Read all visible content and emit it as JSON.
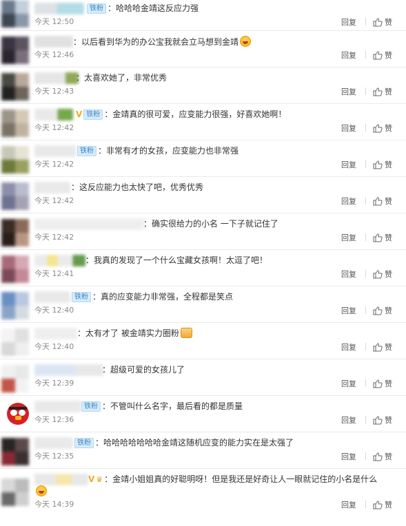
{
  "comments": [
    {
      "badge": "铁粉",
      "verified": false,
      "crown": false,
      "text": "哈哈哈金靖这反应力强",
      "emoji": "",
      "time": "今天 12:50"
    },
    {
      "badge": "",
      "verified": false,
      "crown": false,
      "text": "以后看到华为的办公宝我就会立马想到金靖",
      "emoji": "laugh",
      "time": "今天 12:46"
    },
    {
      "badge": "",
      "verified": false,
      "crown": false,
      "text": "太喜欢她了，非常优秀",
      "emoji": "",
      "time": "今天 12:43"
    },
    {
      "badge": "铁粉",
      "verified": true,
      "crown": false,
      "text": "金靖真的很可爱，应变能力很强，好喜欢她啊！",
      "emoji": "",
      "time": "今天 12:42"
    },
    {
      "badge": "铁粉",
      "verified": false,
      "crown": false,
      "text": "非常有才的女孩，应变能力也非常强",
      "emoji": "",
      "time": "今天 12:42"
    },
    {
      "badge": "",
      "verified": false,
      "crown": false,
      "text": "这反应能力也太快了吧，优秀优秀",
      "emoji": "",
      "time": "今天 12:42"
    },
    {
      "badge": "",
      "verified": false,
      "crown": false,
      "text": "确实很给力的小名 一下子就记住了",
      "emoji": "",
      "time": "今天 12:42"
    },
    {
      "badge": "",
      "verified": false,
      "crown": false,
      "text": "我真的发现了一个什么宝藏女孩啊！太逗了吧！",
      "emoji": "",
      "time": "今天 12:41"
    },
    {
      "badge": "铁粉",
      "verified": false,
      "crown": false,
      "text": "真的应变能力非常强，全程都是笑点",
      "emoji": "",
      "time": "今天 12:40"
    },
    {
      "badge": "",
      "verified": false,
      "crown": false,
      "text": "太有才了 被金靖实力圈粉",
      "emoji": "thumb",
      "time": "今天 12:40"
    },
    {
      "badge": "",
      "verified": false,
      "crown": false,
      "text": "超级可爱的女孩儿了",
      "emoji": "",
      "time": "今天 12:39"
    },
    {
      "badge": "铁粉",
      "verified": false,
      "crown": false,
      "text": "不管叫什么名字，最后看的都是质量",
      "emoji": "",
      "time": "今天 12:36"
    },
    {
      "badge": "铁粉",
      "verified": false,
      "crown": false,
      "text": "哈哈哈哈哈哈哈金靖这随机应变的能力实在是太强了",
      "emoji": "",
      "time": "今天 12:35"
    },
    {
      "badge": "",
      "verified": true,
      "crown": true,
      "text": "金靖小姐姐真的好聪明呀！但是我还是好奇让人一眼就记住的小名是什么",
      "emoji": "laugh",
      "time": "今天 14:39"
    }
  ],
  "actions": {
    "reply_label": "回复",
    "like_label": "赞"
  },
  "colors": {
    "badge_bg": "#d6ebfa",
    "badge_text": "#3a88c5",
    "divider": "#eaeaea",
    "time": "#8a8a8a"
  }
}
